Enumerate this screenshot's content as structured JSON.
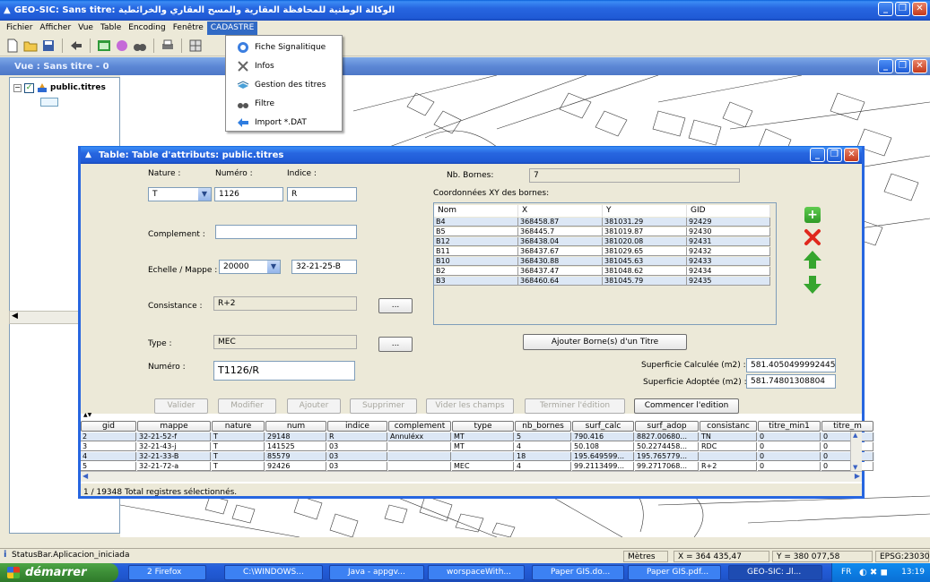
{
  "window": {
    "title": "الوكالة الوطنية للمحافظة العقارية والمسح العقاري والخرائطية :GEO-SIC: Sans titre",
    "app_icon": "app-logo-icon"
  },
  "menubar": {
    "items": [
      "Fichier",
      "Afficher",
      "Vue",
      "Table",
      "Encoding",
      "Fenêtre",
      "CADASTRE"
    ],
    "active": "CADASTRE"
  },
  "cadastre_menu": {
    "items": [
      {
        "label": "Fiche Signalitique",
        "icon": "globe-icon"
      },
      {
        "label": "Infos",
        "icon": "tools-icon"
      },
      {
        "label": "Gestion des titres",
        "icon": "layers-icon"
      },
      {
        "label": "Filtre",
        "icon": "binoculars-icon"
      },
      {
        "label": "Import *.DAT",
        "icon": "arrow-import-icon"
      }
    ]
  },
  "view": {
    "title": "Vue : Sans titre - 0",
    "layer_name": "public.titres"
  },
  "dialog": {
    "title": "Table: Table d'attributs: public.titres",
    "labels": {
      "nature": "Nature :",
      "numero_top": "Numéro :",
      "indice": "Indice :",
      "complement": "Complement :",
      "echelle": "Echelle / Mappe :",
      "consistance": "Consistance :",
      "type": "Type :",
      "numero": "Numéro :",
      "nb_bornes": "Nb. Bornes:",
      "coords": "Coordonnées XY des bornes:",
      "sup_calc": "Superficie Calculée (m2) :",
      "sup_adop": "Superficie Adoptée (m2) :"
    },
    "values": {
      "nature": "T",
      "numero": "1126",
      "indice": "R",
      "complement": "",
      "echelle": "20000",
      "mappe": "32-21-25-B",
      "consistance": "R+2",
      "type": "MEC",
      "numero_titre": "T1126/R",
      "nb_bornes": "7",
      "sup_calc": "581.4050499992445",
      "sup_adop": "581.74801308804"
    },
    "ellipsis": "...",
    "ajouter_bornes": "Ajouter Borne(s) d'un Titre",
    "buttons": {
      "valider": "Valider",
      "modifier": "Modifier",
      "ajouter": "Ajouter",
      "supprimer": "Supprimer",
      "vider": "Vider les champs",
      "terminer": "Terminer l'édition",
      "commencer": "Commencer l'edition"
    },
    "bornes": {
      "columns": [
        "Nom",
        "X",
        "Y",
        "GID"
      ],
      "rows": [
        [
          "B4",
          "368458.87",
          "381031.29",
          "92429"
        ],
        [
          "B5",
          "368445.7",
          "381019.87",
          "92430"
        ],
        [
          "B12",
          "368438.04",
          "381020.08",
          "92431"
        ],
        [
          "B11",
          "368437.67",
          "381029.65",
          "92432"
        ],
        [
          "B10",
          "368430.88",
          "381045.63",
          "92433"
        ],
        [
          "B2",
          "368437.47",
          "381048.62",
          "92434"
        ],
        [
          "B3",
          "368460.64",
          "381045.79",
          "92435"
        ]
      ]
    },
    "grid": {
      "columns": [
        "gid",
        "mappe",
        "nature",
        "num",
        "indice",
        "complement",
        "type",
        "nb_bornes",
        "surf_calc",
        "surf_adop",
        "consistanc",
        "titre_min1",
        "titre_m"
      ],
      "rows": [
        [
          "2",
          "32-21-52-f",
          "T",
          "29148",
          "R",
          "Annuléxx",
          "MT",
          "5",
          "790.416",
          "8827.00680...",
          "TN",
          "0",
          "0"
        ],
        [
          "3",
          "32-21-43-j",
          "T",
          "141525",
          "03",
          "",
          "MT",
          "4",
          "50.108",
          "50.2274458...",
          "RDC",
          "0",
          "0"
        ],
        [
          "4",
          "32-21-33-B",
          "T",
          "85579",
          "03",
          "",
          "",
          "18",
          "195.649599...",
          "195.765779...",
          "",
          "0",
          "0"
        ],
        [
          "5",
          "32-21-72-a",
          "T",
          "92426",
          "03",
          "",
          "MEC",
          "4",
          "99.2113499...",
          "99.2717068...",
          "R+2",
          "0",
          "0"
        ]
      ],
      "status": "1 / 19348 Total registres sélectionnés."
    }
  },
  "statusbar": {
    "message": "StatusBar.Aplicacion_iniciada",
    "units": "Mètres",
    "x": "X = 364 435,47",
    "y": "Y = 380 077,58",
    "epsg": "EPSG:23030"
  },
  "taskbar": {
    "start": "démarrer",
    "tasks": [
      "2 Firefox",
      "C:\\WINDOWS...",
      "Java - appgv...",
      "worspaceWith...",
      "Paper GIS.do...",
      "Paper GIS.pdf...",
      "GEO-SIC: الـ..."
    ],
    "lang": "FR",
    "clock": "13:19"
  },
  "colors": {
    "xp_blue": "#2766e0",
    "selection": "#316ac5",
    "row_highlight": "#dce7f5",
    "add_green": "#36a52e",
    "delete_red": "#e0281d"
  }
}
